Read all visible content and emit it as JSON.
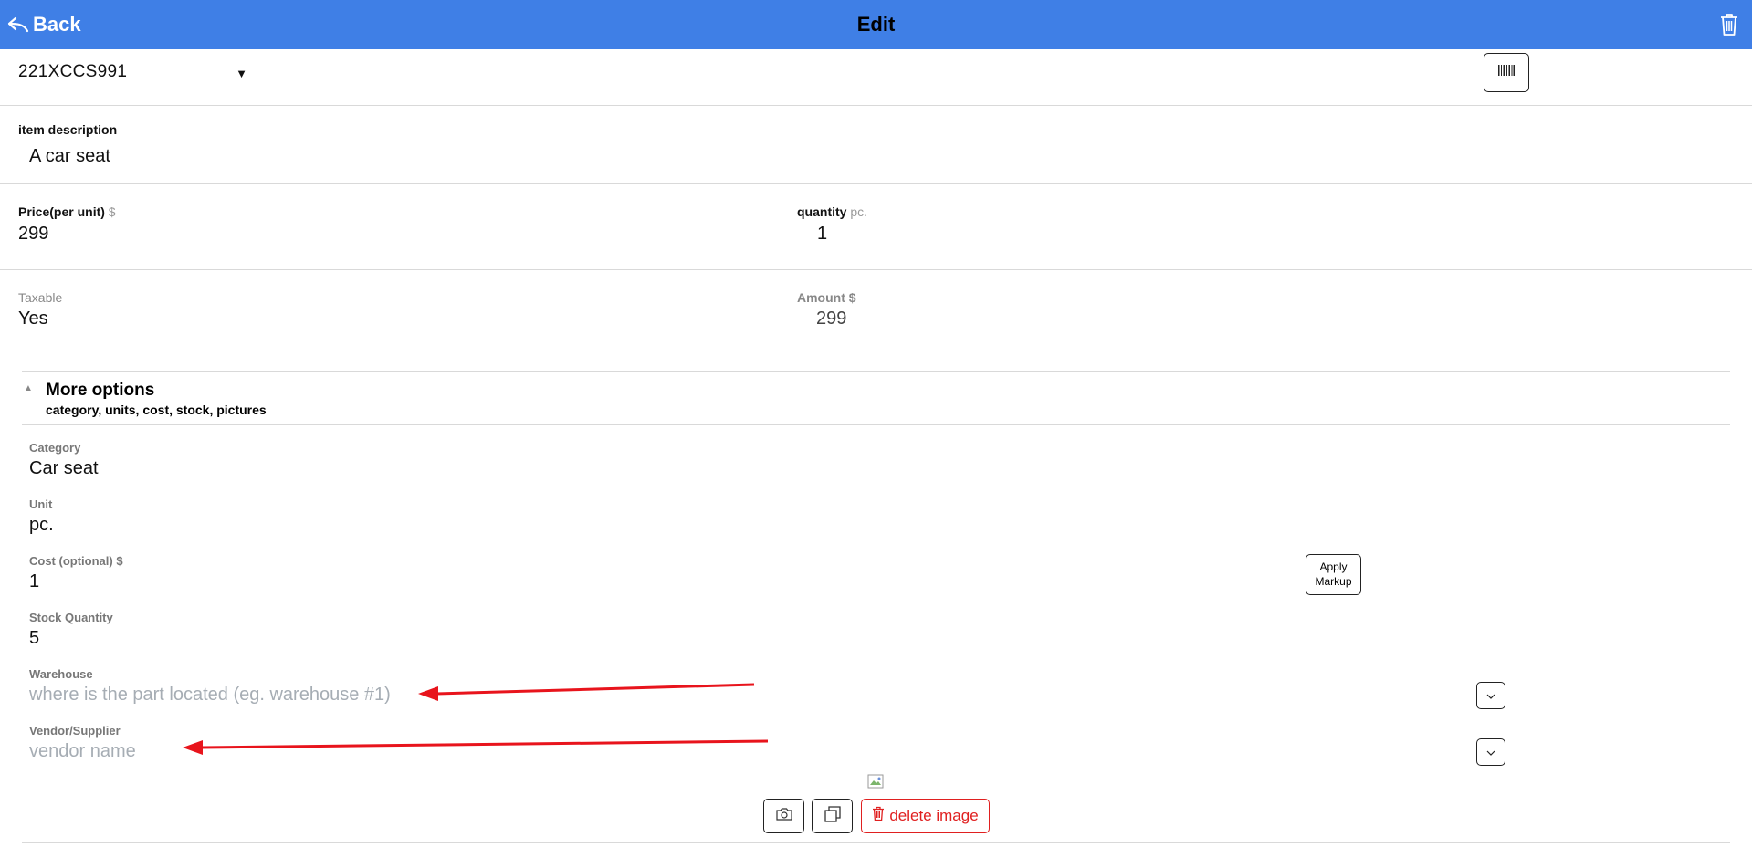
{
  "header": {
    "back_label": "Back",
    "title": "Edit",
    "background": "#3f7fe6"
  },
  "item": {
    "code": "221XCCS991"
  },
  "description": {
    "label": "item description",
    "value": "A car seat"
  },
  "price": {
    "label": "Price(per unit)",
    "unit": "$",
    "value": "299"
  },
  "quantity": {
    "label": "quantity",
    "unit": "pc.",
    "value": "1"
  },
  "taxable": {
    "label": "Taxable",
    "value": "Yes"
  },
  "amount": {
    "label": "Amount $",
    "value": "299"
  },
  "more_options": {
    "title": "More options",
    "subtitle": "category, units, cost, stock, pictures",
    "category": {
      "label": "Category",
      "value": "Car seat"
    },
    "unit": {
      "label": "Unit",
      "value": "pc."
    },
    "cost": {
      "label": "Cost (optional) $",
      "value": "1",
      "apply_button": "Apply Markup"
    },
    "stock": {
      "label": "Stock Quantity",
      "value": "5"
    },
    "warehouse": {
      "label": "Warehouse",
      "placeholder": "where is the part located (eg. warehouse #1)"
    },
    "vendor": {
      "label": "Vendor/Supplier",
      "placeholder": "vendor name"
    }
  },
  "image_actions": {
    "delete_label": "delete image"
  },
  "colors": {
    "accent": "#3f7fe6",
    "danger": "#e02020",
    "annotation_arrow": "#e8141c"
  }
}
